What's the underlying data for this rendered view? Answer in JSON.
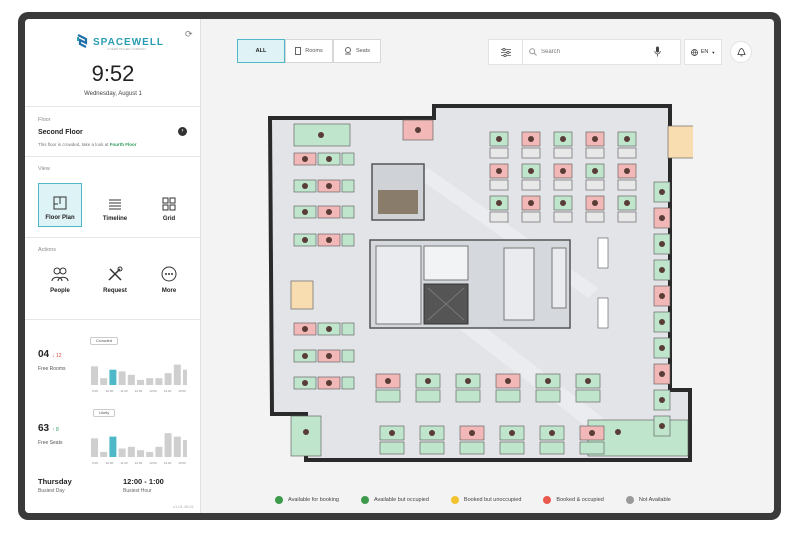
{
  "brand": {
    "name": "SPACEWELL",
    "tagline": "A NEMETSCHEK COMPANY"
  },
  "clock": {
    "time": "9:52",
    "date": "Wednesday, August 1"
  },
  "floor": {
    "label": "Floor",
    "name": "Second Floor",
    "note_prefix": "This floor is crowded, take a look at ",
    "note_link": "Fourth Floor"
  },
  "view": {
    "label": "View",
    "options": [
      {
        "label": "Floor Plan",
        "active": true
      },
      {
        "label": "Timeline",
        "active": false
      },
      {
        "label": "Grid",
        "active": false
      }
    ]
  },
  "actions": {
    "label": "Actions",
    "items": [
      {
        "label": "People"
      },
      {
        "label": "Request"
      },
      {
        "label": "More"
      }
    ]
  },
  "rooms_stat": {
    "value": "04",
    "delta": "↓ 12",
    "label": "Free Rooms",
    "tag": "Crowded",
    "bars": [
      0.55,
      0.2,
      0.45,
      0.4,
      0.3,
      0.15,
      0.2,
      0.2,
      0.35,
      0.6,
      0.45
    ],
    "highlight_index": 2,
    "ticks": [
      "9:00",
      "10:00",
      "11:00",
      "12:00",
      "13:00",
      "14:00",
      "15:00"
    ]
  },
  "seats_stat": {
    "value": "63",
    "delta": "↑ 8",
    "label": "Free Seats",
    "tag": "Likely",
    "bars": [
      0.55,
      0.15,
      0.6,
      0.25,
      0.3,
      0.2,
      0.15,
      0.3,
      0.7,
      0.6,
      0.5
    ],
    "highlight_index": 2,
    "ticks": [
      "9:00",
      "10:00",
      "11:00",
      "12:00",
      "13:00",
      "14:00",
      "15:00"
    ]
  },
  "busiest": {
    "day_value": "Thursday",
    "day_label": "Busiest Day",
    "hour_value": "12:00 - 1:00",
    "hour_label": "Busiest Hour"
  },
  "version": "v1.01.45.01",
  "tabs": [
    {
      "label": "ALL",
      "active": true,
      "icon": "grid-icon"
    },
    {
      "label": "Rooms",
      "active": false,
      "icon": "door-icon"
    },
    {
      "label": "Seats",
      "active": false,
      "icon": "chair-icon"
    }
  ],
  "search": {
    "placeholder": "Search"
  },
  "language": {
    "value": "EN"
  },
  "legend": [
    {
      "label": "Available for booking",
      "color": "#3d9a4a"
    },
    {
      "label": "Available but occupied",
      "color": "#3d9a4a"
    },
    {
      "label": "Booked but unoccupied",
      "color": "#f2c230"
    },
    {
      "label": "Booked & occupied",
      "color": "#e8584c"
    },
    {
      "label": "Not Available",
      "color": "#9a9a9a"
    }
  ],
  "colors": {
    "accent": "#4fb8c8",
    "available": "#bfe6cc",
    "booked_occupied": "#f2b7b7",
    "booked_unoccupied": "#f7ddb0",
    "bar": "#cfcfcf"
  }
}
